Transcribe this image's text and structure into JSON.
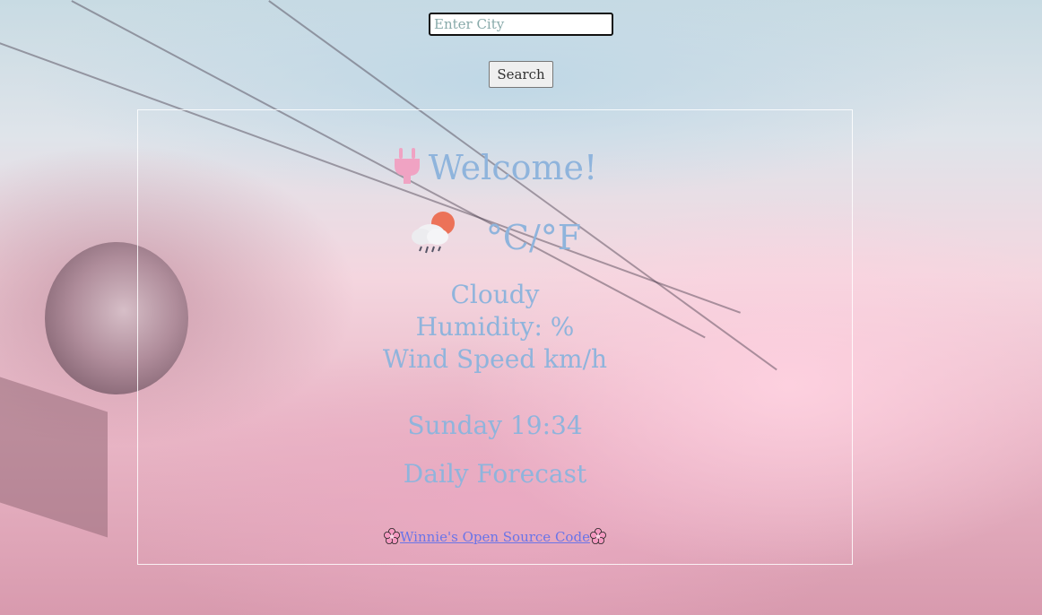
{
  "search": {
    "placeholder": "Enter City",
    "value": "",
    "button_label": "Search"
  },
  "weather": {
    "welcome_text": "Welcome!",
    "welcome_icon": "plug-icon",
    "condition_icon": "sun-behind-rain-cloud-icon",
    "temperature_units": "°C/°F",
    "description": "Cloudy",
    "humidity": "Humidity: %",
    "wind_speed": "Wind Speed km/h",
    "datetime": "Sunday 19:34",
    "forecast_title": "Daily Forecast"
  },
  "footer": {
    "link_text": "Winnie's Open Source Code",
    "link_icon": "cherry-blossom-icon"
  },
  "colors": {
    "accent_text": "#8fb4dc",
    "link": "#6a74e8",
    "plug_pink": "#f0a3c3"
  }
}
